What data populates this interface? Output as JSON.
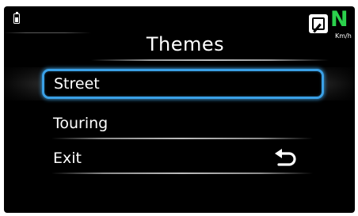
{
  "status_bar": {
    "battery_icon": "battery-icon",
    "gear": {
      "icon": "gear-box-icon",
      "letter": "N",
      "letter_color": "#2bd14c"
    },
    "speed_unit": "Km/h"
  },
  "menu": {
    "title": "Themes",
    "items": [
      {
        "label": "Street",
        "selected": true
      },
      {
        "label": "Touring",
        "selected": false
      },
      {
        "label": "Exit",
        "selected": false,
        "icon": "back-arrow-icon"
      }
    ],
    "highlight_color": "#3aa0e6"
  }
}
